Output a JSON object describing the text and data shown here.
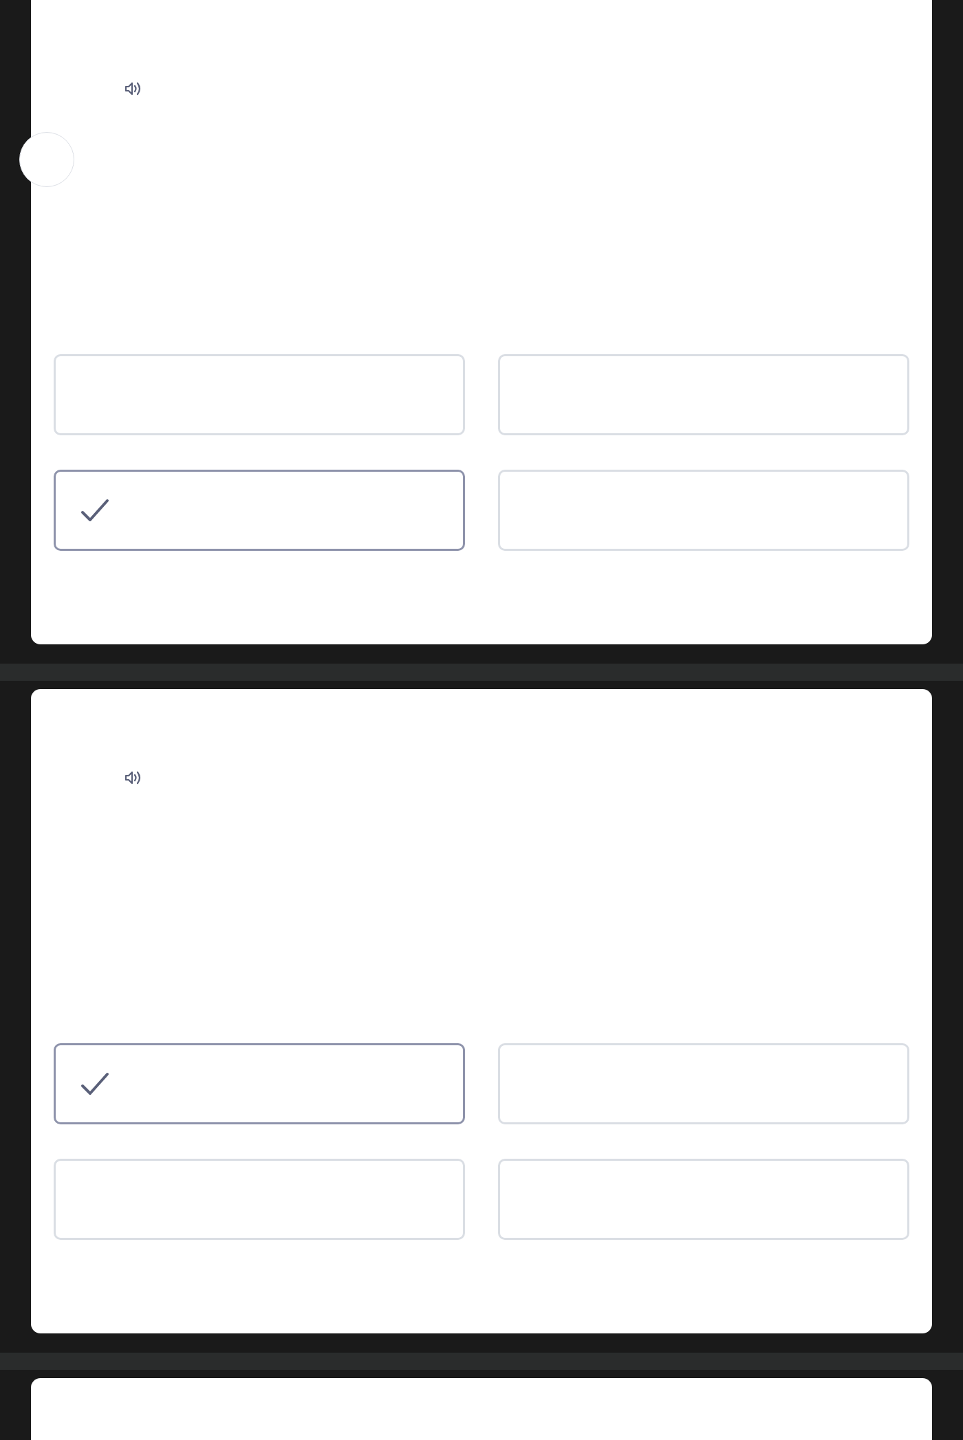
{
  "cards": [
    {
      "bubble": true,
      "options": [
        {
          "selected": false
        },
        {
          "selected": false
        },
        {
          "selected": true
        },
        {
          "selected": false
        }
      ]
    },
    {
      "bubble": false,
      "options": [
        {
          "selected": true
        },
        {
          "selected": false
        },
        {
          "selected": false
        },
        {
          "selected": false
        }
      ]
    },
    {
      "kind": "partial"
    }
  ]
}
